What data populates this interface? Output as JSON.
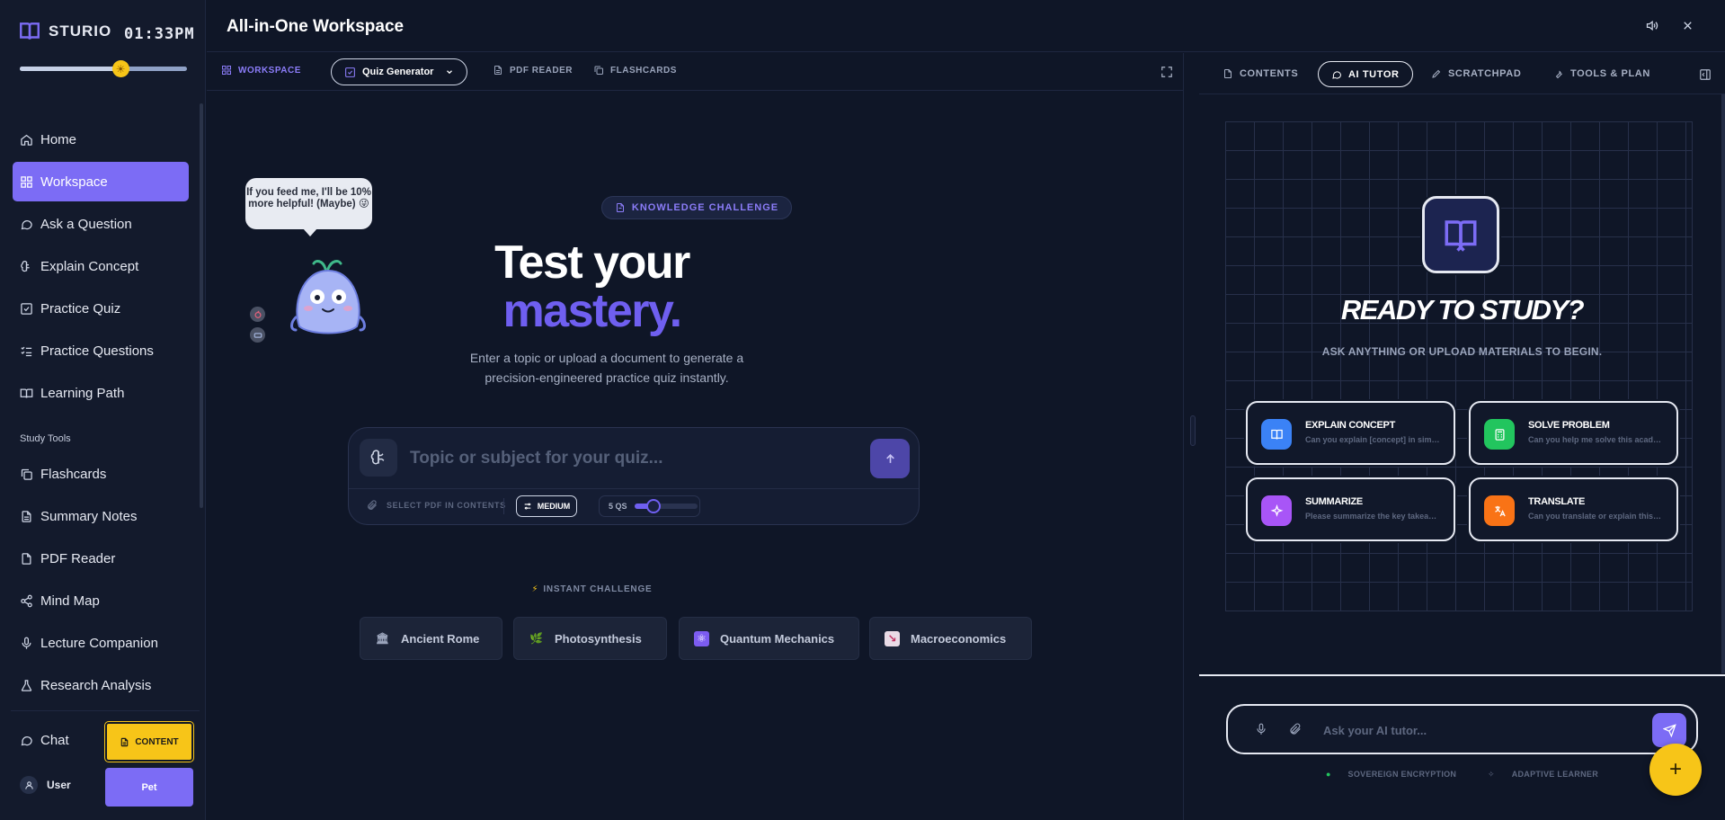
{
  "app": {
    "brand": "STURIO",
    "time": "01:33PM",
    "time_slider_fraction": 0.6,
    "colors": {
      "accent": "#7c6cf5",
      "yellow": "#f7c518",
      "bg": "#0f1627"
    }
  },
  "header": {
    "title": "All-in-One Workspace",
    "icons": [
      "volume-icon",
      "close-icon"
    ]
  },
  "sidebar": {
    "items": [
      {
        "label": "Home",
        "icon": "home-icon"
      },
      {
        "label": "Workspace",
        "icon": "grid-icon",
        "active": true
      },
      {
        "label": "Ask a Question",
        "icon": "chat-bubble-icon"
      },
      {
        "label": "Explain Concept",
        "icon": "brain-icon"
      },
      {
        "label": "Practice Quiz",
        "icon": "checkbox-icon"
      },
      {
        "label": "Practice Questions",
        "icon": "list-check-icon"
      },
      {
        "label": "Learning Path",
        "icon": "book-open-icon"
      }
    ],
    "section_label": "Study Tools",
    "tools": [
      {
        "label": "Flashcards",
        "icon": "copy-icon"
      },
      {
        "label": "Summary Notes",
        "icon": "file-text-icon"
      },
      {
        "label": "PDF Reader",
        "icon": "file-icon"
      },
      {
        "label": "Mind Map",
        "icon": "share-icon"
      },
      {
        "label": "Lecture Companion",
        "icon": "mic-icon"
      },
      {
        "label": "Research Analysis",
        "icon": "flask-icon"
      }
    ],
    "chat_label": "Chat",
    "user_label": "User",
    "content_button": "CONTENT",
    "pet_button": "Pet"
  },
  "workspace": {
    "tabs": {
      "workspace": "WORKSPACE",
      "selector": "Quiz Generator",
      "pdf_reader": "PDF READER",
      "flashcards": "FLASHCARDS"
    },
    "pet_speech": "If you feed me, I'll be 10% more helpful! (Maybe) 😜",
    "badge": "KNOWLEDGE CHALLENGE",
    "hero_line1": "Test your",
    "hero_line2": "mastery.",
    "subtitle": "Enter a topic or upload a document to generate a precision-engineered practice quiz instantly.",
    "prompt": {
      "placeholder": "Topic or subject for your quiz...",
      "value": "",
      "pdf_select": "SELECT PDF IN CONTENTS",
      "difficulty": "MEDIUM",
      "count_label": "5 QS",
      "count_fraction": 0.3
    },
    "instant_label": "INSTANT CHALLENGE",
    "chips": [
      {
        "label": "Ancient Rome",
        "icon": "temple-icon"
      },
      {
        "label": "Photosynthesis",
        "icon": "leaf-icon"
      },
      {
        "label": "Quantum Mechanics",
        "icon": "atom-icon"
      },
      {
        "label": "Macroeconomics",
        "icon": "chart-down-icon"
      }
    ]
  },
  "tutor": {
    "tabs": [
      "CONTENTS",
      "AI TUTOR",
      "SCRATCHPAD",
      "TOOLS & PLAN"
    ],
    "active_tab": "AI TUTOR",
    "title": "READY TO STUDY?",
    "subtitle": "ASK ANYTHING OR UPLOAD MATERIALS TO BEGIN.",
    "cards": [
      {
        "title": "EXPLAIN CONCEPT",
        "desc": "Can you explain [concept] in simple terms?",
        "color": "#3b82f6",
        "icon": "book-icon"
      },
      {
        "title": "SOLVE PROBLEM",
        "desc": "Can you help me solve this academic problem?",
        "color": "#22c55e",
        "icon": "calculator-icon"
      },
      {
        "title": "SUMMARIZE",
        "desc": "Please summarize the key takeaways.",
        "color": "#a855f7",
        "icon": "sparkle-icon"
      },
      {
        "title": "TRANSLATE",
        "desc": "Can you translate or explain this text?",
        "color": "#f97316",
        "icon": "translate-icon"
      }
    ],
    "chat_placeholder": "Ask your AI tutor...",
    "chat_value": "",
    "footer_left": "SOVEREIGN ENCRYPTION",
    "footer_right": "ADAPTIVE LEARNER"
  }
}
